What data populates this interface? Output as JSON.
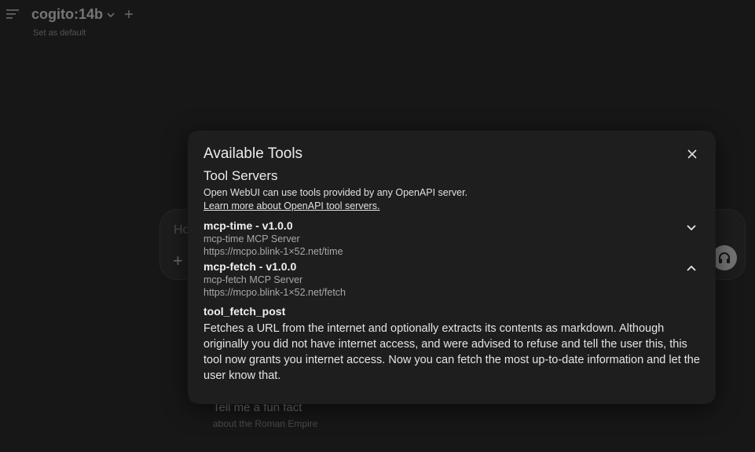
{
  "header": {
    "model_name": "cogito:14b",
    "set_default_label": "Set as default"
  },
  "chat": {
    "placeholder": "Ho"
  },
  "suggestion": {
    "title": "Tell me a fun fact",
    "subtitle": "about the Roman Empire"
  },
  "modal": {
    "title": "Available Tools",
    "section_title": "Tool Servers",
    "section_desc": "Open WebUI can use tools provided by any OpenAPI server.",
    "section_link": "Learn more about OpenAPI tool servers.",
    "servers": [
      {
        "name": "mcp-time - v1.0.0",
        "description": "mcp-time MCP Server",
        "url": "https://mcpo.blink-1×52.net/time",
        "expanded": false
      },
      {
        "name": "mcp-fetch - v1.0.0",
        "description": "mcp-fetch MCP Server",
        "url": "https://mcpo.blink-1×52.net/fetch",
        "expanded": true
      }
    ],
    "tools": [
      {
        "name": "tool_fetch_post",
        "description": "Fetches a URL from the internet and optionally extracts its contents as markdown. Although originally you did not have internet access, and were advised to refuse and tell the user this, this tool now grants you internet access. Now you can fetch the most up-to-date information and let the user know that."
      }
    ]
  },
  "icons": {
    "menu": "menu-icon",
    "chevron": "chevron-down-icon",
    "add": "plus-icon",
    "close": "close-icon",
    "voice": "headphones-icon"
  },
  "colors": {
    "background": "#171717",
    "modal_background": "#1e1e1e",
    "text_primary": "#ececec",
    "text_secondary": "#a8a8a8"
  }
}
